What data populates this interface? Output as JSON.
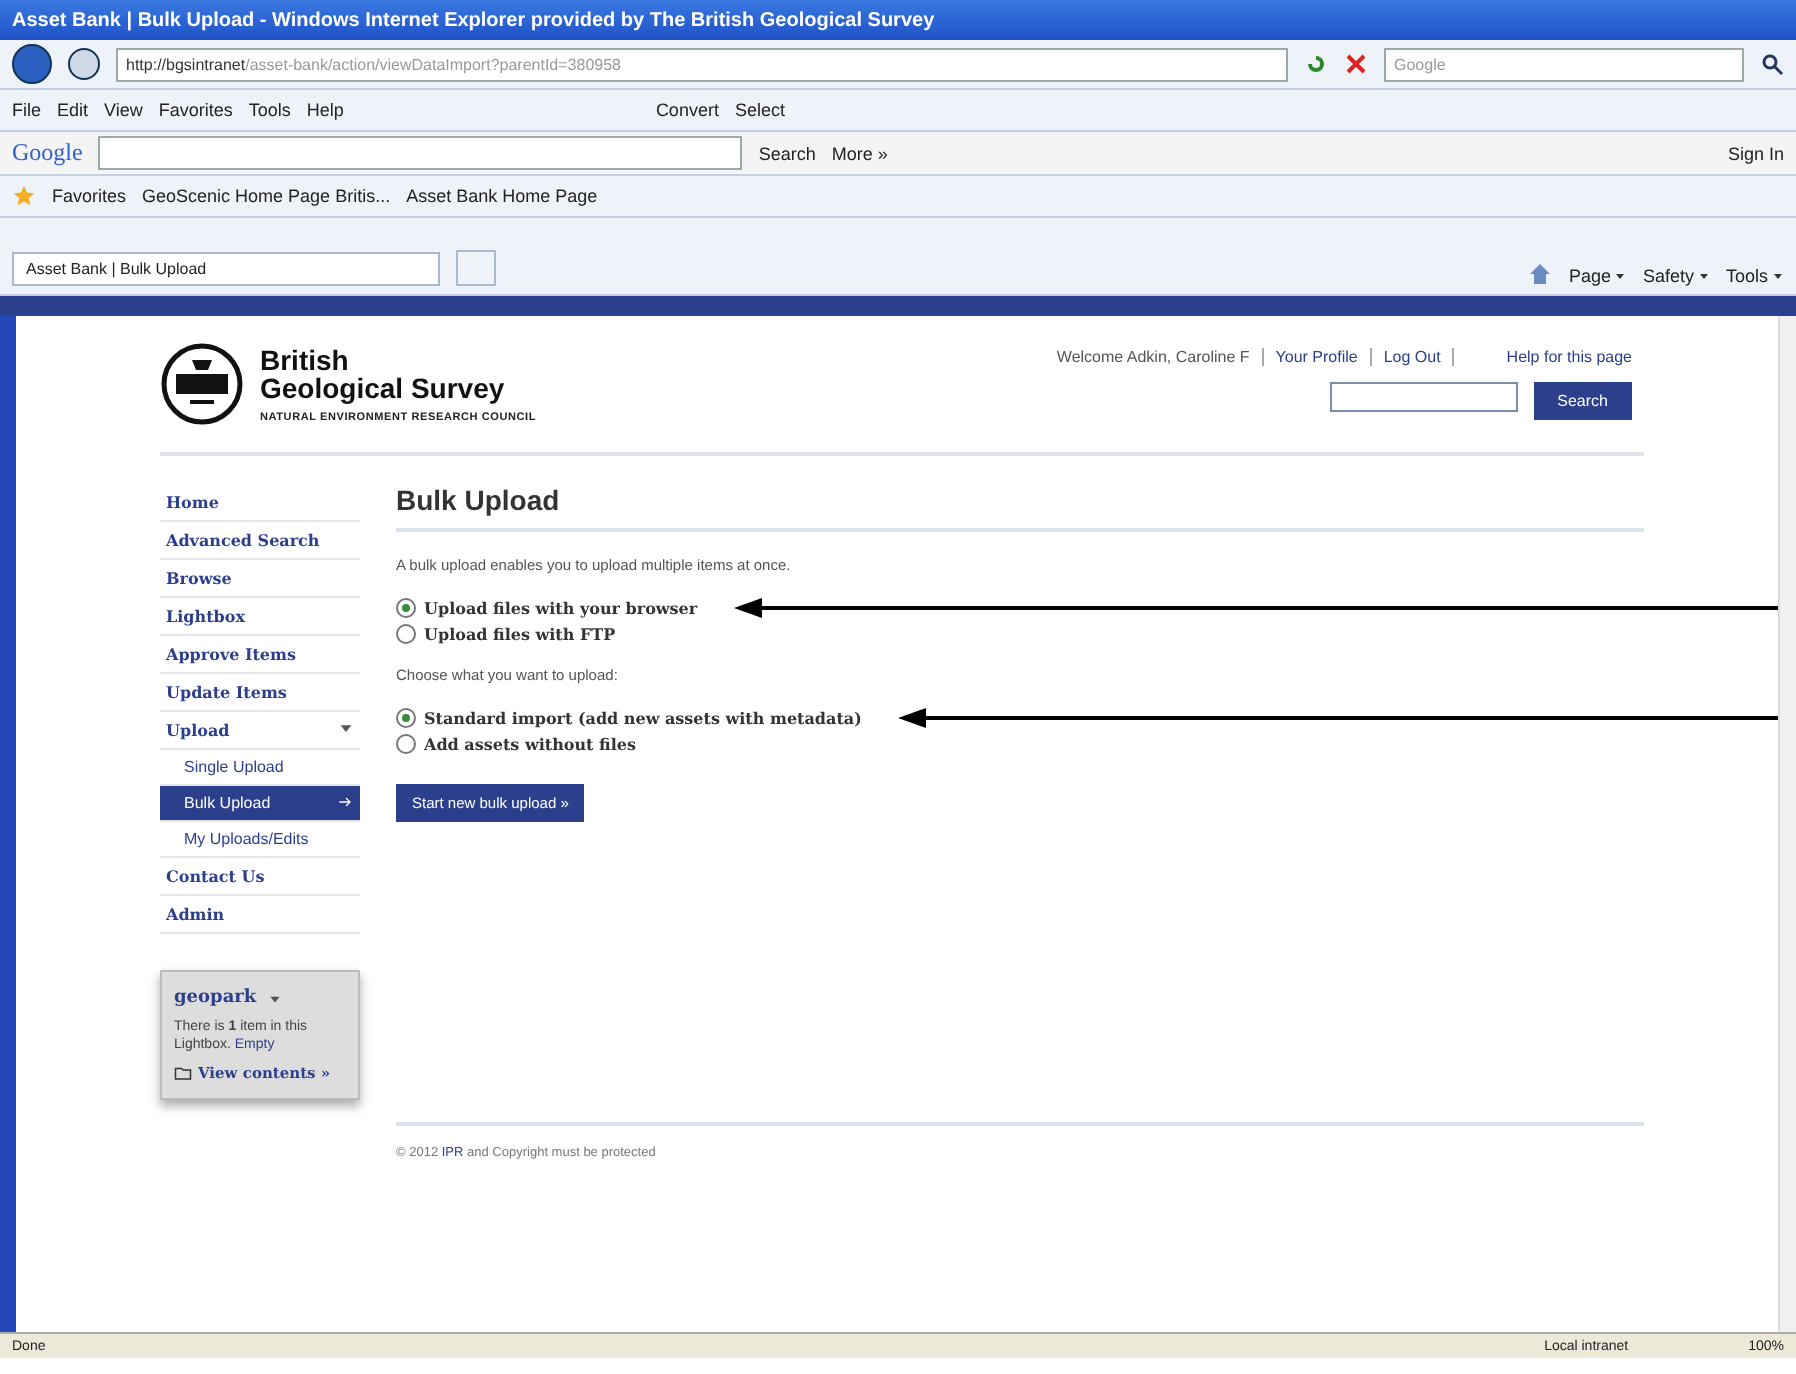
{
  "window": {
    "title": "Asset Bank | Bulk Upload - Windows Internet Explorer provided by The British Geological Survey"
  },
  "address_bar": {
    "url_host": "http://bgsintranet",
    "url_path": "/asset-bank/action/viewDataImport?parentId=380958",
    "search_placeholder": "Google"
  },
  "menu_bar": {
    "items": [
      "File",
      "Edit",
      "View",
      "Favorites",
      "Tools",
      "Help"
    ],
    "tools": [
      "Convert",
      "Select"
    ]
  },
  "google_toolbar": {
    "logo": "Google",
    "search": "Search",
    "more": "More »",
    "sign_in": "Sign In"
  },
  "favorites_bar": {
    "label": "Favorites",
    "links": [
      "GeoScenic Home Page Britis...",
      "Asset Bank Home Page"
    ]
  },
  "tabs": [
    {
      "label": "Asset Bank | Bulk Upload",
      "selected": true
    }
  ],
  "command_bar": [
    "Page",
    "Safety",
    "Tools"
  ],
  "header": {
    "org_name": "British",
    "org_name_2": "Geological Survey",
    "council": "NATURAL ENVIRONMENT RESEARCH COUNCIL",
    "welcome": "Welcome Adkin, Caroline F",
    "links": [
      "Your Profile",
      "Log Out"
    ],
    "help": "Help for this page",
    "search_button": "Search"
  },
  "sidebar": {
    "items": [
      {
        "label": "Home",
        "selected": false
      },
      {
        "label": "Advanced Search",
        "selected": false
      },
      {
        "label": "Browse",
        "selected": false
      },
      {
        "label": "Lightbox",
        "selected": false
      },
      {
        "label": "Approve Items",
        "selected": false
      },
      {
        "label": "Update Items",
        "selected": false
      },
      {
        "label": "Upload",
        "selected": false,
        "expanded": true,
        "children": [
          {
            "label": "Single Upload",
            "selected": false
          },
          {
            "label": "Bulk Upload",
            "selected": true
          },
          {
            "label": "My Uploads/Edits",
            "selected": false
          }
        ]
      },
      {
        "label": "Contact Us",
        "selected": false
      },
      {
        "label": "Admin",
        "selected": false
      }
    ]
  },
  "lightbox": {
    "name": "geopark",
    "text_before": "There is ",
    "count": "1",
    "text_after": " item in this Lightbox.",
    "empty": "Empty",
    "view": "View contents »"
  },
  "main": {
    "title": "Bulk Upload",
    "intro": "A bulk upload enables you to upload multiple items at once.",
    "methods": [
      {
        "label": "Upload files with your browser",
        "selected": true,
        "arrow": true
      },
      {
        "label": "Upload files with FTP",
        "selected": false,
        "arrow": false
      }
    ],
    "prompt": "Choose what you want to upload:",
    "imports": [
      {
        "label": "Standard import (add new assets with metadata)",
        "selected": true,
        "arrow": true
      },
      {
        "label": "Add assets without files",
        "selected": false,
        "arrow": false
      }
    ],
    "button": "Start new bulk upload »"
  },
  "footer": {
    "year": "© 2012",
    "owner": "IPR",
    "rest": " and Copyright must be protected"
  },
  "status_bar": {
    "status": "Done",
    "zone": "Local intranet",
    "zoom": "100%"
  }
}
